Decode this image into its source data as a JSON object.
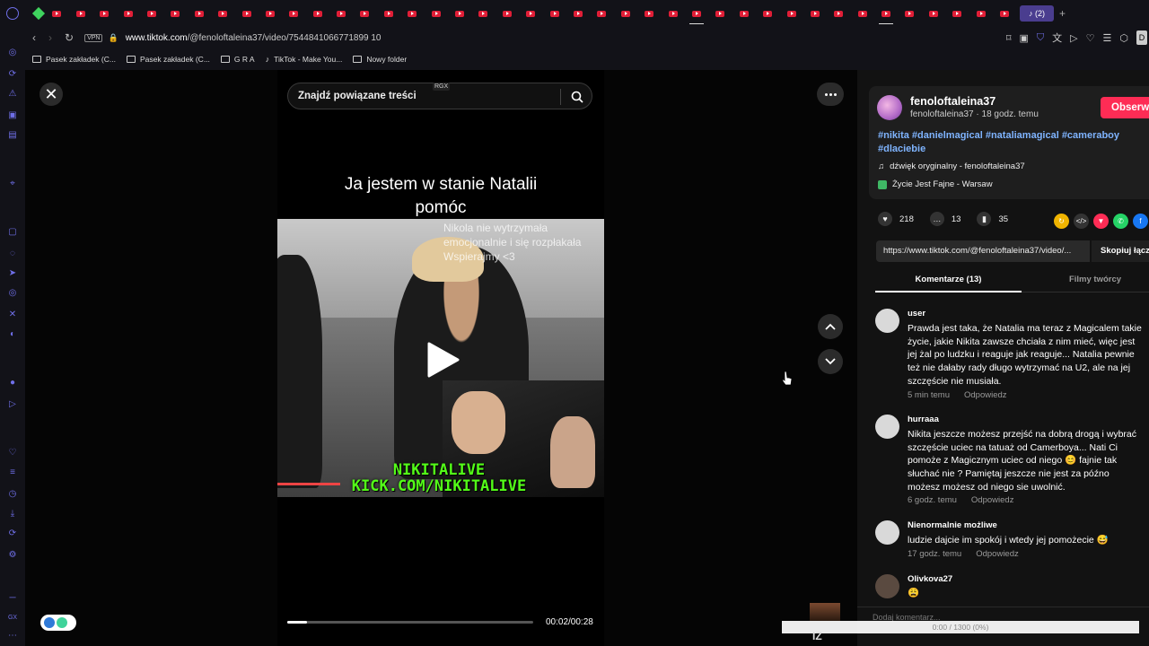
{
  "browser": {
    "url_host": "www.tiktok.com",
    "url_path": "/@fenoloftaleina37/video/7544841066771899 10",
    "url_full": "www.tiktok.com/@fenoloftaleina37/video/7544841066771899 10",
    "vpn_label": "VPN",
    "active_tab_label": "(2)",
    "profile_initial": "D",
    "bookmarks": [
      "Pasek zakładek (C...",
      "Pasek zakładek (C...",
      "G R A",
      "TikTok - Make You...",
      "Nowy folder"
    ]
  },
  "video": {
    "search_placeholder": "Znajdź powiązane treści",
    "rgx_badge": "RGX",
    "caption_line1": "Ja jestem w stanie Natalii",
    "caption_line2": "pomóc",
    "overlay_text_1": "Nikola nie wytrzymała",
    "overlay_text_2": "emocjonalnie i się rozpłakała",
    "overlay_text_3": "Wspierajmy <3",
    "kick_line1": "NIKITALIVE",
    "kick_line2": "KICK.COM/NIKITALIVE",
    "time": "00:02/00:28",
    "progress": 0.08
  },
  "author": {
    "username": "fenoloftaleina37",
    "subline": "fenoloftaleina37 · 18 godz. temu",
    "follow_label": "Obserwuj",
    "hashtags": "#nikita #danielmagical #nataliamagical #cameraboy #dlaciebie",
    "sound": "dźwięk oryginalny - fenoloftaleina37",
    "place": "Życie Jest Fajne - Warsaw"
  },
  "stats": {
    "likes": "218",
    "comments": "13",
    "saves": "35"
  },
  "share": {
    "link": "https://www.tiktok.com/@fenoloftaleina37/video/...",
    "copy_label": "Skopiuj łącze"
  },
  "tabs": {
    "comments_tab": "Komentarze (13)",
    "creator_tab": "Filmy twórcy"
  },
  "comments": [
    {
      "name": "user",
      "text": "Prawda jest taka, że Natalia ma teraz z Magicalem takie życie, jakie Nikita zawsze chciała z nim mieć, więc jest jej żal po ludzku i reaguje jak reaguje... Natalia pewnie też nie dałaby rady długo wytrzymać na U2, ale na jej szczęście nie musiała.",
      "time": "5 min temu",
      "reply": "Odpowiedz"
    },
    {
      "name": "hurraaa",
      "text": "Nikita jeszcze możesz przejść na dobrą drogą i wybrać szczęście uciec na tatuaż od Camerboya... Nati Ci pomoże z Magicznym uciec od niego 😊 fajnie tak słuchać nie ? Pamiętaj jeszcze nie jest za późno możesz możesz od niego sie uwolnić.",
      "time": "6 godz. temu",
      "reply": "Odpowiedz"
    },
    {
      "name": "Nienormalnie możliwe",
      "text": "ludzie dajcie im spokój i wtedy jej pomożecie 😅",
      "time": "17 godz. temu",
      "reply": "Odpowiedz"
    },
    {
      "name": "Olivkova27",
      "text": "😩",
      "time": "",
      "reply": ""
    }
  ],
  "bottom": {
    "comment_placeholder": "Dodaj komentarz...",
    "overlay_progress": "0:00 / 1300 (0%)",
    "thumb_label": "IZ"
  },
  "colors": {
    "accent": "#fe2c55",
    "hashtag": "#7fb4ff",
    "kick": "#53fc18",
    "browser_icon": "#6f6fe8"
  }
}
